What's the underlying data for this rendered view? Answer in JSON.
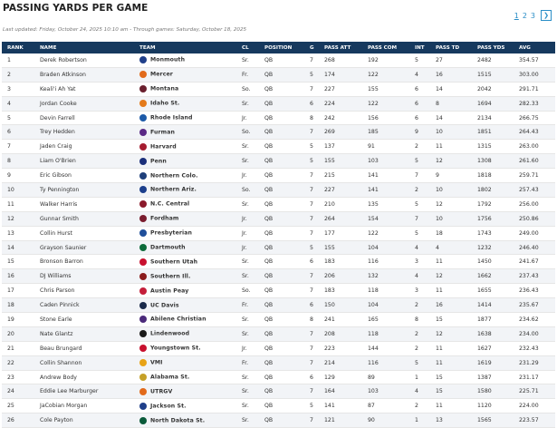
{
  "page": {
    "title": "PASSING YARDS PER GAME",
    "updated": "Last updated: Friday, October 24, 2025 10:10 am - Through games: Saturday, October 18, 2025"
  },
  "pagination": {
    "pages": [
      "1",
      "2",
      "3"
    ],
    "current": "1",
    "next_icon": "next-page-icon"
  },
  "columns": [
    "RANK",
    "NAME",
    "TEAM",
    "CL",
    "POSITION",
    "G",
    "PASS ATT",
    "PASS COM",
    "INT",
    "PASS TD",
    "PASS YDS",
    "AVG"
  ],
  "rows": [
    {
      "rank": "1",
      "name": "Derek Robertson",
      "team": "Monmouth",
      "cl": "Sr.",
      "pos": "QB",
      "g": "7",
      "att": "268",
      "com": "192",
      "int": "5",
      "td": "27",
      "yds": "2482",
      "avg": "354.57",
      "color": "#1f3f8a"
    },
    {
      "rank": "2",
      "name": "Braden Atkinson",
      "team": "Mercer",
      "cl": "Fr.",
      "pos": "QB",
      "g": "5",
      "att": "174",
      "com": "122",
      "int": "4",
      "td": "16",
      "yds": "1515",
      "avg": "303.00",
      "color": "#e26a1b"
    },
    {
      "rank": "3",
      "name": "Keali'i Ah Yat",
      "team": "Montana",
      "cl": "So.",
      "pos": "QB",
      "g": "7",
      "att": "227",
      "com": "155",
      "int": "6",
      "td": "14",
      "yds": "2042",
      "avg": "291.71",
      "color": "#6a1f2e"
    },
    {
      "rank": "4",
      "name": "Jordan Cooke",
      "team": "Idaho St.",
      "cl": "Sr.",
      "pos": "QB",
      "g": "6",
      "att": "224",
      "com": "122",
      "int": "6",
      "td": "8",
      "yds": "1694",
      "avg": "282.33",
      "color": "#e47b1c"
    },
    {
      "rank": "5",
      "name": "Devin Farrell",
      "team": "Rhode Island",
      "cl": "Jr.",
      "pos": "QB",
      "g": "8",
      "att": "242",
      "com": "156",
      "int": "6",
      "td": "14",
      "yds": "2134",
      "avg": "266.75",
      "color": "#1c5aa8"
    },
    {
      "rank": "6",
      "name": "Trey Hedden",
      "team": "Furman",
      "cl": "So.",
      "pos": "QB",
      "g": "7",
      "att": "269",
      "com": "185",
      "int": "9",
      "td": "10",
      "yds": "1851",
      "avg": "264.43",
      "color": "#5b2a86"
    },
    {
      "rank": "7",
      "name": "Jaden Craig",
      "team": "Harvard",
      "cl": "Sr.",
      "pos": "QB",
      "g": "5",
      "att": "137",
      "com": "91",
      "int": "2",
      "td": "11",
      "yds": "1315",
      "avg": "263.00",
      "color": "#a51c30"
    },
    {
      "rank": "8",
      "name": "Liam O'Brien",
      "team": "Penn",
      "cl": "Sr.",
      "pos": "QB",
      "g": "5",
      "att": "155",
      "com": "103",
      "int": "5",
      "td": "12",
      "yds": "1308",
      "avg": "261.60",
      "color": "#1b2f7a"
    },
    {
      "rank": "9",
      "name": "Eric Gibson",
      "team": "Northern Colo.",
      "cl": "Jr.",
      "pos": "QB",
      "g": "7",
      "att": "215",
      "com": "141",
      "int": "7",
      "td": "9",
      "yds": "1818",
      "avg": "259.71",
      "color": "#1e3f7a"
    },
    {
      "rank": "10",
      "name": "Ty Pennington",
      "team": "Northern Ariz.",
      "cl": "So.",
      "pos": "QB",
      "g": "7",
      "att": "227",
      "com": "141",
      "int": "2",
      "td": "10",
      "yds": "1802",
      "avg": "257.43",
      "color": "#1c3f8c"
    },
    {
      "rank": "11",
      "name": "Walker Harris",
      "team": "N.C. Central",
      "cl": "Sr.",
      "pos": "QB",
      "g": "7",
      "att": "210",
      "com": "135",
      "int": "5",
      "td": "12",
      "yds": "1792",
      "avg": "256.00",
      "color": "#8b1a2b"
    },
    {
      "rank": "12",
      "name": "Gunnar Smith",
      "team": "Fordham",
      "cl": "Jr.",
      "pos": "QB",
      "g": "7",
      "att": "264",
      "com": "154",
      "int": "7",
      "td": "10",
      "yds": "1756",
      "avg": "250.86",
      "color": "#7a1c2e"
    },
    {
      "rank": "13",
      "name": "Collin Hurst",
      "team": "Presbyterian",
      "cl": "Jr.",
      "pos": "QB",
      "g": "7",
      "att": "177",
      "com": "122",
      "int": "5",
      "td": "18",
      "yds": "1743",
      "avg": "249.00",
      "color": "#1f4f9a"
    },
    {
      "rank": "14",
      "name": "Grayson Saunier",
      "team": "Dartmouth",
      "cl": "Jr.",
      "pos": "QB",
      "g": "5",
      "att": "155",
      "com": "104",
      "int": "4",
      "td": "4",
      "yds": "1232",
      "avg": "246.40",
      "color": "#0d6b3a"
    },
    {
      "rank": "15",
      "name": "Bronson Barron",
      "team": "Southern Utah",
      "cl": "Sr.",
      "pos": "QB",
      "g": "6",
      "att": "183",
      "com": "116",
      "int": "3",
      "td": "11",
      "yds": "1450",
      "avg": "241.67",
      "color": "#c8102e"
    },
    {
      "rank": "16",
      "name": "DJ Williams",
      "team": "Southern Ill.",
      "cl": "Sr.",
      "pos": "QB",
      "g": "7",
      "att": "206",
      "com": "132",
      "int": "4",
      "td": "12",
      "yds": "1662",
      "avg": "237.43",
      "color": "#8b1c1c"
    },
    {
      "rank": "17",
      "name": "Chris Parson",
      "team": "Austin Peay",
      "cl": "So.",
      "pos": "QB",
      "g": "7",
      "att": "183",
      "com": "118",
      "int": "3",
      "td": "11",
      "yds": "1655",
      "avg": "236.43",
      "color": "#c41e3a"
    },
    {
      "rank": "18",
      "name": "Caden Pinnick",
      "team": "UC Davis",
      "cl": "Fr.",
      "pos": "QB",
      "g": "6",
      "att": "150",
      "com": "104",
      "int": "2",
      "td": "16",
      "yds": "1414",
      "avg": "235.67",
      "color": "#1a2a4a"
    },
    {
      "rank": "19",
      "name": "Stone Earle",
      "team": "Abilene Christian",
      "cl": "Sr.",
      "pos": "QB",
      "g": "8",
      "att": "241",
      "com": "165",
      "int": "8",
      "td": "15",
      "yds": "1877",
      "avg": "234.62",
      "color": "#4b2a7a"
    },
    {
      "rank": "20",
      "name": "Nate Glantz",
      "team": "Lindenwood",
      "cl": "Sr.",
      "pos": "QB",
      "g": "7",
      "att": "208",
      "com": "118",
      "int": "2",
      "td": "12",
      "yds": "1638",
      "avg": "234.00",
      "color": "#1a1a1a"
    },
    {
      "rank": "21",
      "name": "Beau Brungard",
      "team": "Youngstown St.",
      "cl": "Jr.",
      "pos": "QB",
      "g": "7",
      "att": "223",
      "com": "144",
      "int": "2",
      "td": "11",
      "yds": "1627",
      "avg": "232.43",
      "color": "#c8102e"
    },
    {
      "rank": "22",
      "name": "Collin Shannon",
      "team": "VMI",
      "cl": "Fr.",
      "pos": "QB",
      "g": "7",
      "att": "214",
      "com": "116",
      "int": "5",
      "td": "11",
      "yds": "1619",
      "avg": "231.29",
      "color": "#e8a317"
    },
    {
      "rank": "23",
      "name": "Andrew Body",
      "team": "Alabama St.",
      "cl": "Sr.",
      "pos": "QB",
      "g": "6",
      "att": "129",
      "com": "89",
      "int": "1",
      "td": "15",
      "yds": "1387",
      "avg": "231.17",
      "color": "#c5a028"
    },
    {
      "rank": "24",
      "name": "Eddie Lee Marburger",
      "team": "UTRGV",
      "cl": "Sr.",
      "pos": "QB",
      "g": "7",
      "att": "164",
      "com": "103",
      "int": "4",
      "td": "15",
      "yds": "1580",
      "avg": "225.71",
      "color": "#e26a1b"
    },
    {
      "rank": "25",
      "name": "JaCobian Morgan",
      "team": "Jackson St.",
      "cl": "Sr.",
      "pos": "QB",
      "g": "5",
      "att": "141",
      "com": "87",
      "int": "2",
      "td": "11",
      "yds": "1120",
      "avg": "224.00",
      "color": "#1f3f8a"
    },
    {
      "rank": "26",
      "name": "Cole Payton",
      "team": "North Dakota St.",
      "cl": "Sr.",
      "pos": "QB",
      "g": "7",
      "att": "121",
      "com": "90",
      "int": "1",
      "td": "13",
      "yds": "1565",
      "avg": "223.57",
      "color": "#0a5a3a"
    }
  ]
}
